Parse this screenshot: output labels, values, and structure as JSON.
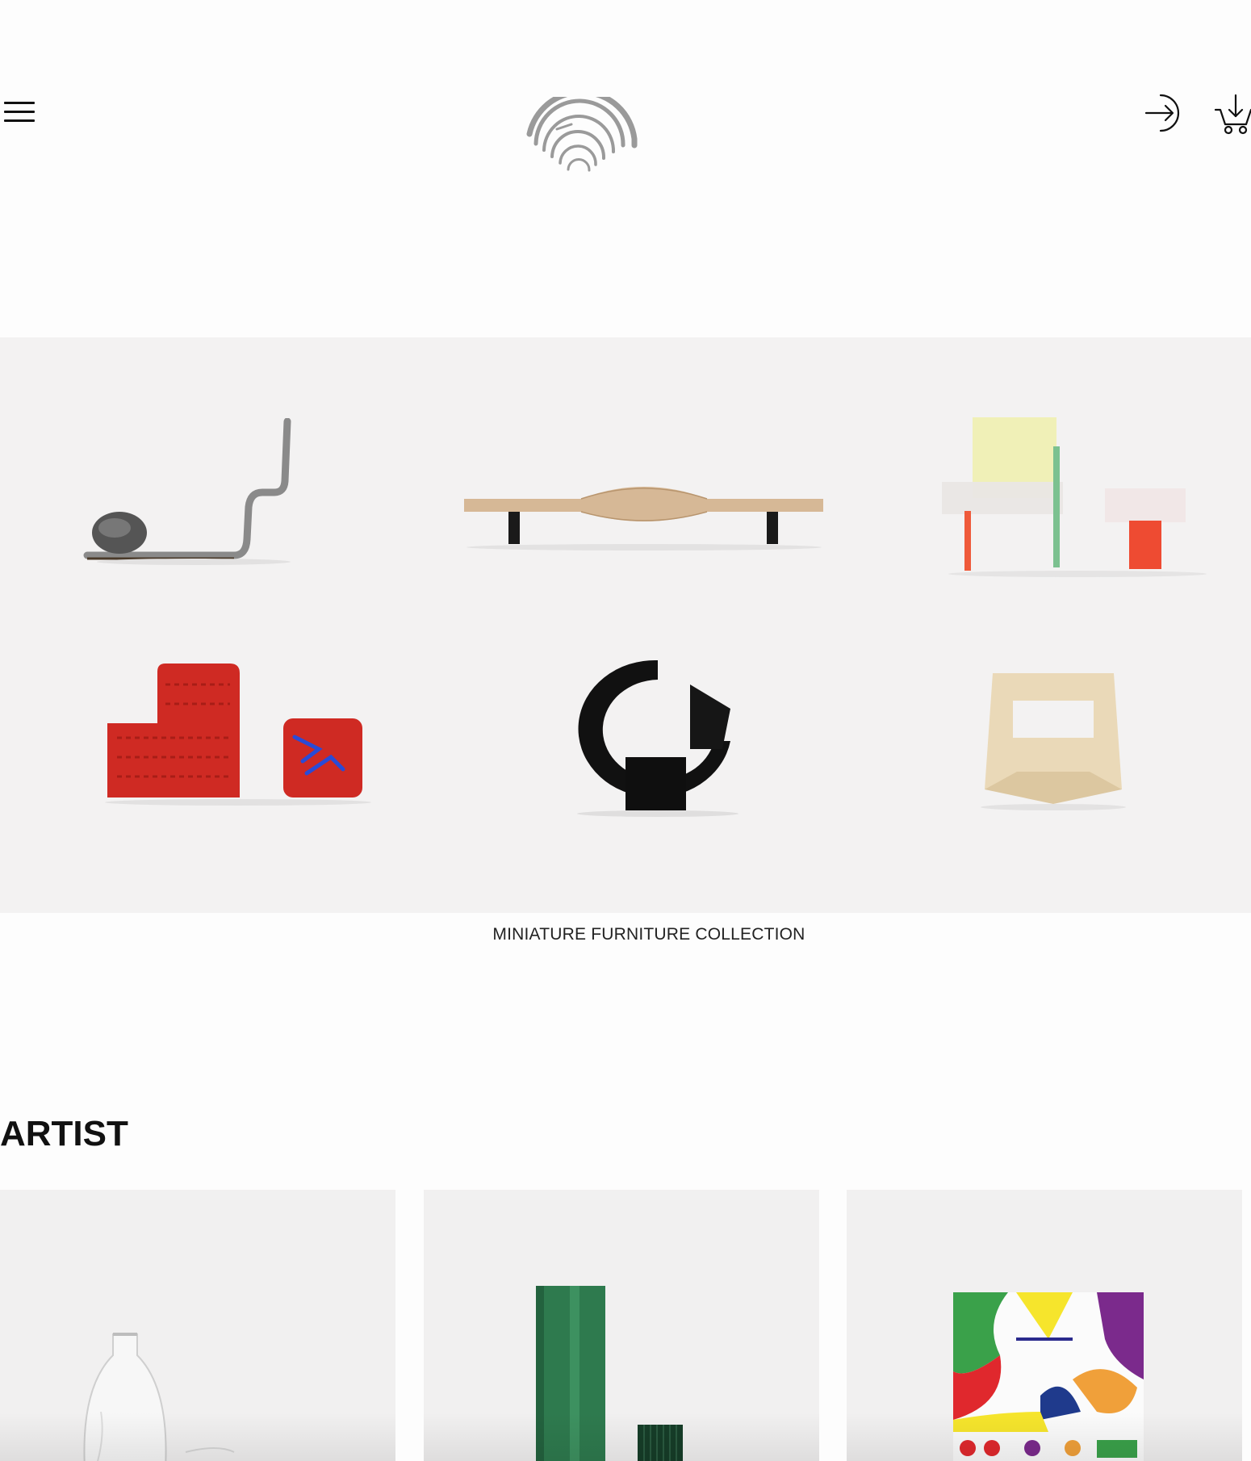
{
  "header": {
    "menu_icon": "hamburger-icon",
    "logo_icon": "arch-logo-icon",
    "login_icon": "login-arrow-icon",
    "cart_icon": "shopping-cart-icon"
  },
  "hero": {
    "caption": "MINIATURE FURNITURE COLLECTION",
    "items": [
      {
        "name": "bent-metal-lounge-with-stone"
      },
      {
        "name": "wooden-wave-bench"
      },
      {
        "name": "acrylic-chair-and-side-table"
      },
      {
        "name": "red-knit-armchair-and-ottoman"
      },
      {
        "name": "black-loop-sculpture-chair"
      },
      {
        "name": "plywood-stool"
      }
    ]
  },
  "artist": {
    "heading": "ARTIST",
    "cards": [
      {
        "subject": "glass-bottle"
      },
      {
        "subject": "green-aluminum-vase"
      },
      {
        "subject": "colorful-book-cover"
      }
    ]
  },
  "colors": {
    "hero_bg": "#f3f2f2",
    "text": "#111111",
    "logo_gray": "#9a9a9a"
  }
}
